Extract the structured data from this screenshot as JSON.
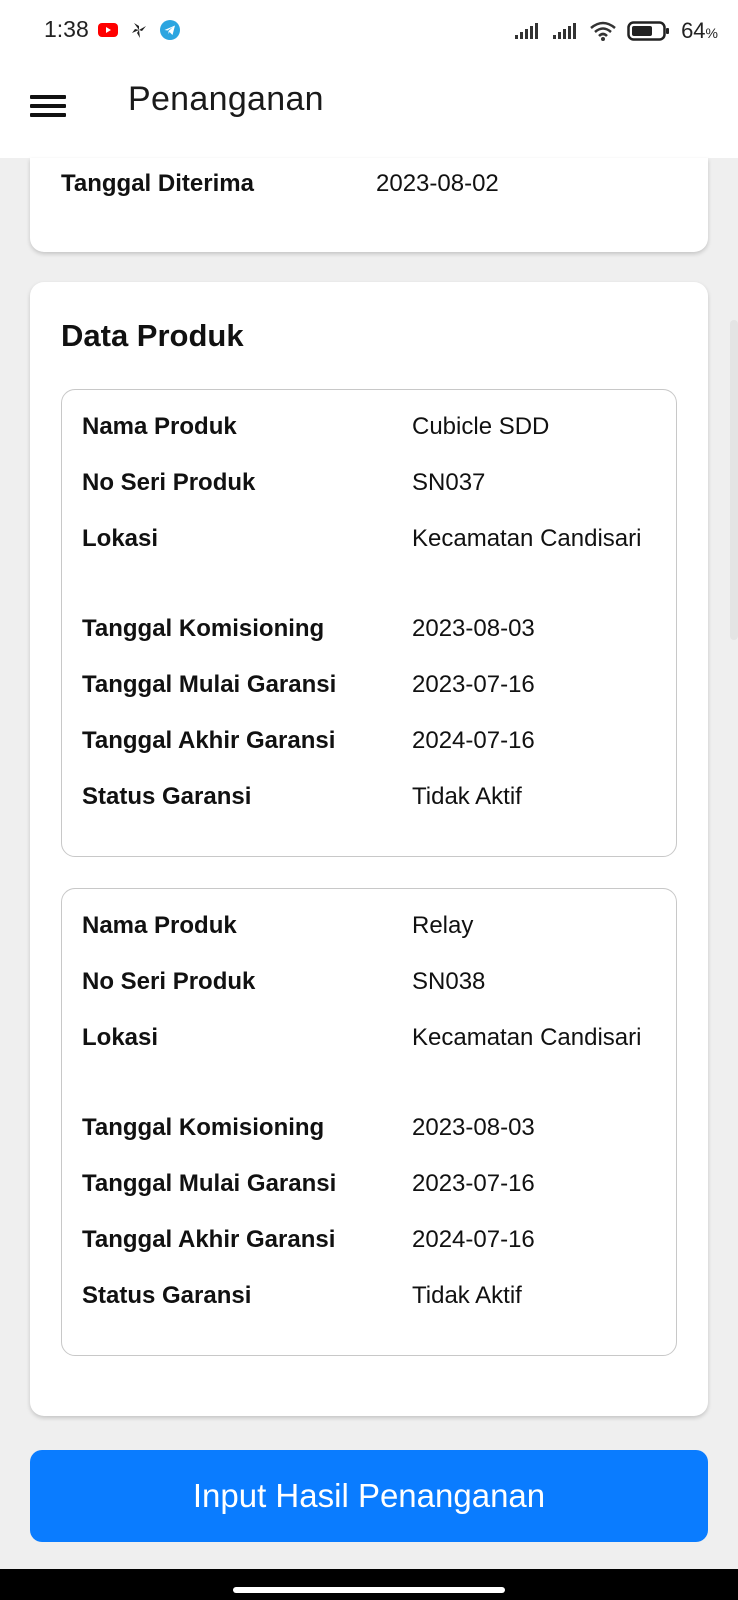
{
  "status_bar": {
    "time": "1:38",
    "battery": "64",
    "battery_unit": "%"
  },
  "app_bar": {
    "title": "Penanganan"
  },
  "top_card": {
    "label": "Tanggal Diterima",
    "value": "2023-08-02"
  },
  "data_produk": {
    "title": "Data Produk",
    "products": [
      {
        "rows": [
          {
            "key": "Nama Produk",
            "value": "Cubicle SDD"
          },
          {
            "key": "No Seri Produk",
            "value": "SN037"
          },
          {
            "key": "Lokasi",
            "value": "Kecamatan Candisari"
          },
          {
            "key": "Tanggal Komisioning",
            "value": "2023-08-03"
          },
          {
            "key": "Tanggal Mulai Garansi",
            "value": "2023-07-16"
          },
          {
            "key": "Tanggal Akhir Garansi",
            "value": "2024-07-16"
          },
          {
            "key": "Status Garansi",
            "value": "Tidak Aktif"
          }
        ]
      },
      {
        "rows": [
          {
            "key": "Nama Produk",
            "value": "Relay"
          },
          {
            "key": "No Seri Produk",
            "value": "SN038"
          },
          {
            "key": "Lokasi",
            "value": "Kecamatan Candisari"
          },
          {
            "key": "Tanggal Komisioning",
            "value": "2023-08-03"
          },
          {
            "key": "Tanggal Mulai Garansi",
            "value": "2023-07-16"
          },
          {
            "key": "Tanggal Akhir Garansi",
            "value": "2024-07-16"
          },
          {
            "key": "Status Garansi",
            "value": "Tidak Aktif"
          }
        ]
      }
    ]
  },
  "action": {
    "label": "Input Hasil Penanganan",
    "color": "#0a7cff"
  },
  "icons": {
    "status_left": [
      "youtube-icon",
      "pinwheel-icon",
      "telegram-icon"
    ],
    "status_right": [
      "signal-icon",
      "signal-icon",
      "wifi-icon",
      "battery-icon"
    ],
    "app_bar": "hamburger-menu-icon"
  }
}
